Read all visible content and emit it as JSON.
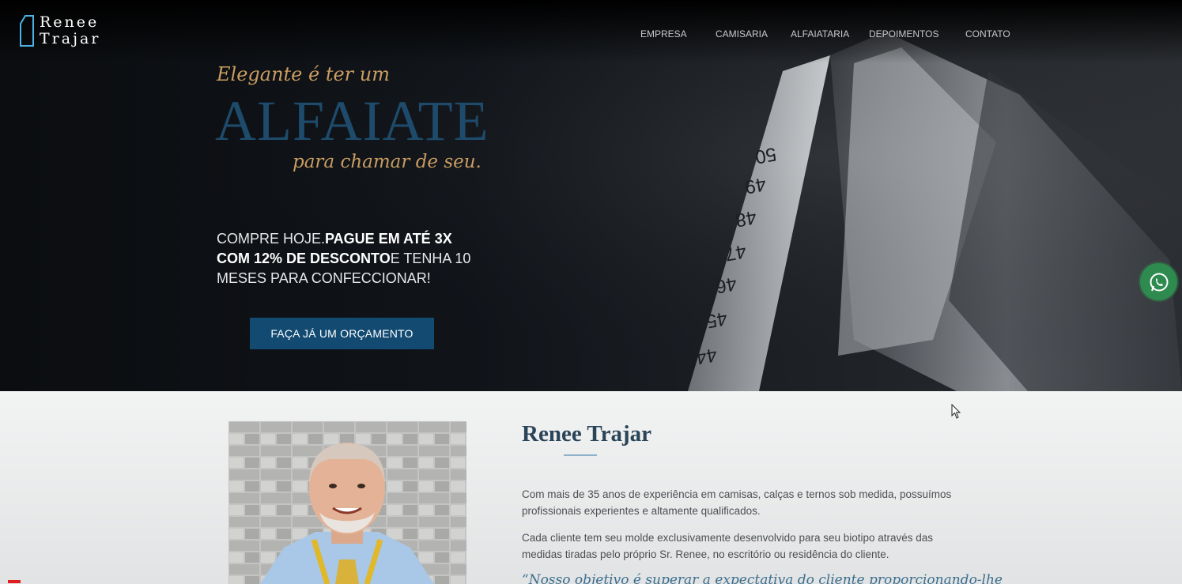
{
  "brand": {
    "line1": "Renee",
    "line2": "Trajar"
  },
  "nav": [
    {
      "label": "EMPRESA"
    },
    {
      "label": "CAMISARIA"
    },
    {
      "label": "ALFAIATARIA"
    },
    {
      "label": "DEPOIMENTOS"
    },
    {
      "label": "CONTATO"
    }
  ],
  "hero": {
    "kicker": "Elegante é ter um",
    "headline": "ALFAIATE",
    "tagline": "para chamar de seu.",
    "promo": {
      "part1": "COMPRE HOJE.",
      "part2": "PAGUE EM ATÉ 3X COM 12% DE DESCONTO",
      "part3": "E TENHA 10 MESES PARA CONFECCIONAR!"
    },
    "cta_label": "FAÇA JÁ UM ORÇAMENTO",
    "tape_numbers": [
      "50",
      "49",
      "48",
      "47",
      "46",
      "45",
      "44"
    ]
  },
  "about": {
    "title": "Renee Trajar",
    "paragraph1": "Com mais de 35 anos de experiência em camisas, calças e ternos sob medida, possuímos profissionais experientes e altamente qualificados.",
    "paragraph2": "Cada cliente tem seu molde exclusivamente desenvolvido para seu biotipo através das medidas tiradas pelo próprio Sr. Renee, no escritório ou residência do cliente.",
    "quote": "“Nosso objetivo é superar a expectativa do cliente proporcionando-lhe"
  },
  "colors": {
    "accent_gold": "#c99d62",
    "headline_blue": "#1e4b6b",
    "cta_blue": "#124a72",
    "whatsapp_green": "#2e8a4e"
  }
}
